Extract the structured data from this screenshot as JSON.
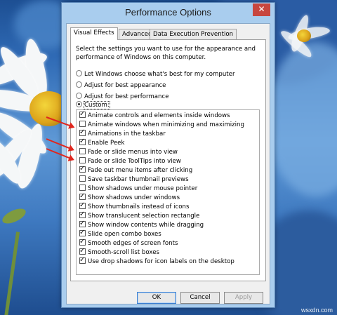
{
  "window": {
    "title": "Performance Options",
    "close_label": "✕"
  },
  "tabs": [
    {
      "label": "Visual Effects",
      "active": true
    },
    {
      "label": "Advanced",
      "active": false
    },
    {
      "label": "Data Execution Prevention",
      "active": false
    }
  ],
  "description": "Select the settings you want to use for the appearance and performance of Windows on this computer.",
  "radio_options": [
    {
      "label": "Let Windows choose what's best for my computer",
      "selected": false
    },
    {
      "label": "Adjust for best appearance",
      "selected": false
    },
    {
      "label": "Adjust for best performance",
      "selected": false
    },
    {
      "label": "Custom:",
      "selected": true
    }
  ],
  "effects": [
    {
      "label": "Animate controls and elements inside windows",
      "checked": true
    },
    {
      "label": "Animate windows when minimizing and maximizing",
      "checked": false
    },
    {
      "label": "Animations in the taskbar",
      "checked": true
    },
    {
      "label": "Enable Peek",
      "checked": true
    },
    {
      "label": "Fade or slide menus into view",
      "checked": false
    },
    {
      "label": "Fade or slide ToolTips into view",
      "checked": false
    },
    {
      "label": "Fade out menu items after clicking",
      "checked": true
    },
    {
      "label": "Save taskbar thumbnail previews",
      "checked": false
    },
    {
      "label": "Show shadows under mouse pointer",
      "checked": false
    },
    {
      "label": "Show shadows under windows",
      "checked": true
    },
    {
      "label": "Show thumbnails instead of icons",
      "checked": true
    },
    {
      "label": "Show translucent selection rectangle",
      "checked": true
    },
    {
      "label": "Show window contents while dragging",
      "checked": true
    },
    {
      "label": "Slide open combo boxes",
      "checked": true
    },
    {
      "label": "Smooth edges of screen fonts",
      "checked": true
    },
    {
      "label": "Smooth-scroll list boxes",
      "checked": true
    },
    {
      "label": "Use drop shadows for icon labels on the desktop",
      "checked": true
    }
  ],
  "buttons": {
    "ok": "OK",
    "cancel": "Cancel",
    "apply": "Apply"
  },
  "annotation_color": "#e0261d",
  "watermark": "wsxdn.com"
}
